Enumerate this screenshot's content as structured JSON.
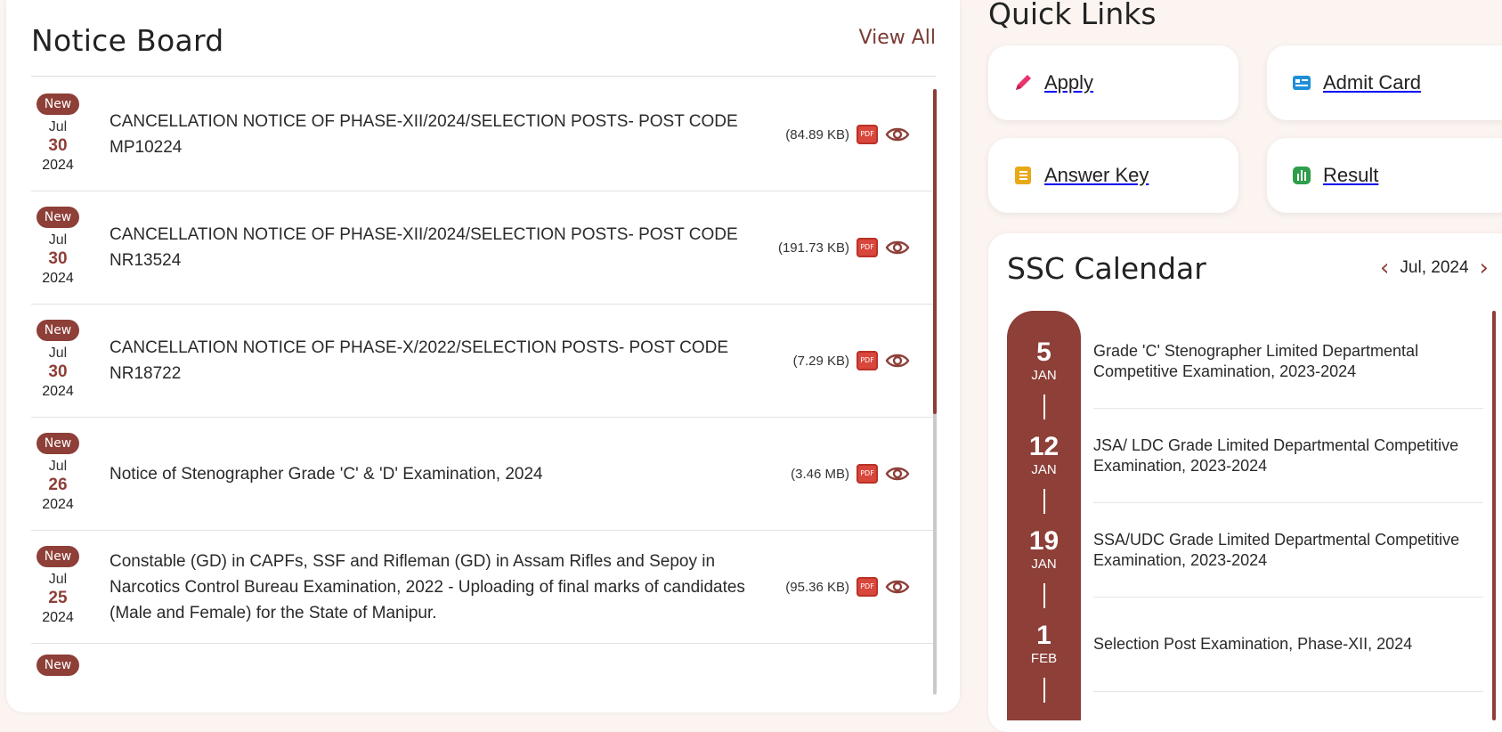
{
  "notice_board": {
    "title": "Notice Board",
    "view_all": "View All",
    "notices": [
      {
        "badge": "New",
        "month": "Jul",
        "day": "30",
        "year": "2024",
        "text": "CANCELLATION NOTICE OF PHASE-XII/2024/SELECTION POSTS- POST CODE MP10224",
        "size": "(84.89 KB)",
        "pdf": "PDF"
      },
      {
        "badge": "New",
        "month": "Jul",
        "day": "30",
        "year": "2024",
        "text": "CANCELLATION NOTICE OF PHASE-XII/2024/SELECTION POSTS- POST CODE NR13524",
        "size": "(191.73 KB)",
        "pdf": "PDF"
      },
      {
        "badge": "New",
        "month": "Jul",
        "day": "30",
        "year": "2024",
        "text": "CANCELLATION NOTICE OF PHASE-X/2022/SELECTION POSTS- POST CODE NR18722",
        "size": "(7.29 KB)",
        "pdf": "PDF"
      },
      {
        "badge": "New",
        "month": "Jul",
        "day": "26",
        "year": "2024",
        "text": "Notice of Stenographer Grade 'C' & 'D' Examination, 2024",
        "size": "(3.46 MB)",
        "pdf": "PDF"
      },
      {
        "badge": "New",
        "month": "Jul",
        "day": "25",
        "year": "2024",
        "text": "Constable (GD) in CAPFs, SSF and Rifleman (GD) in Assam Rifles and Sepoy in Narcotics Control Bureau Examination, 2022 - Uploading of final marks of candidates (Male and Female) for the State of Manipur.",
        "size": "(95.36 KB)",
        "pdf": "PDF"
      },
      {
        "badge": "New"
      }
    ]
  },
  "quick_links": {
    "title": "Quick Links",
    "items": [
      {
        "label": "Apply",
        "icon": "pencil-icon",
        "color": "#e8336b"
      },
      {
        "label": "Admit Card",
        "icon": "id-card-icon",
        "color": "#1e8fd6"
      },
      {
        "label": "Answer Key",
        "icon": "notebook-icon",
        "color": "#e8a917"
      },
      {
        "label": "Result",
        "icon": "bar-chart-icon",
        "color": "#2e9e4a"
      }
    ]
  },
  "calendar": {
    "title": "SSC Calendar",
    "month": "Jul, 2024",
    "entries": [
      {
        "day": "5",
        "month": "JAN",
        "text": "Grade 'C' Stenographer Limited Departmental Competitive Examination, 2023-2024"
      },
      {
        "day": "12",
        "month": "JAN",
        "text": "JSA/ LDC Grade Limited Departmental Competitive Examination, 2023-2024"
      },
      {
        "day": "19",
        "month": "JAN",
        "text": "SSA/UDC Grade Limited Departmental Competitive Examination, 2023-2024"
      },
      {
        "day": "1",
        "month": "FEB",
        "text": "Selection Post Examination, Phase-XII, 2024"
      }
    ]
  },
  "colors": {
    "accent": "#8d3f38",
    "background": "#fbf4f1"
  }
}
